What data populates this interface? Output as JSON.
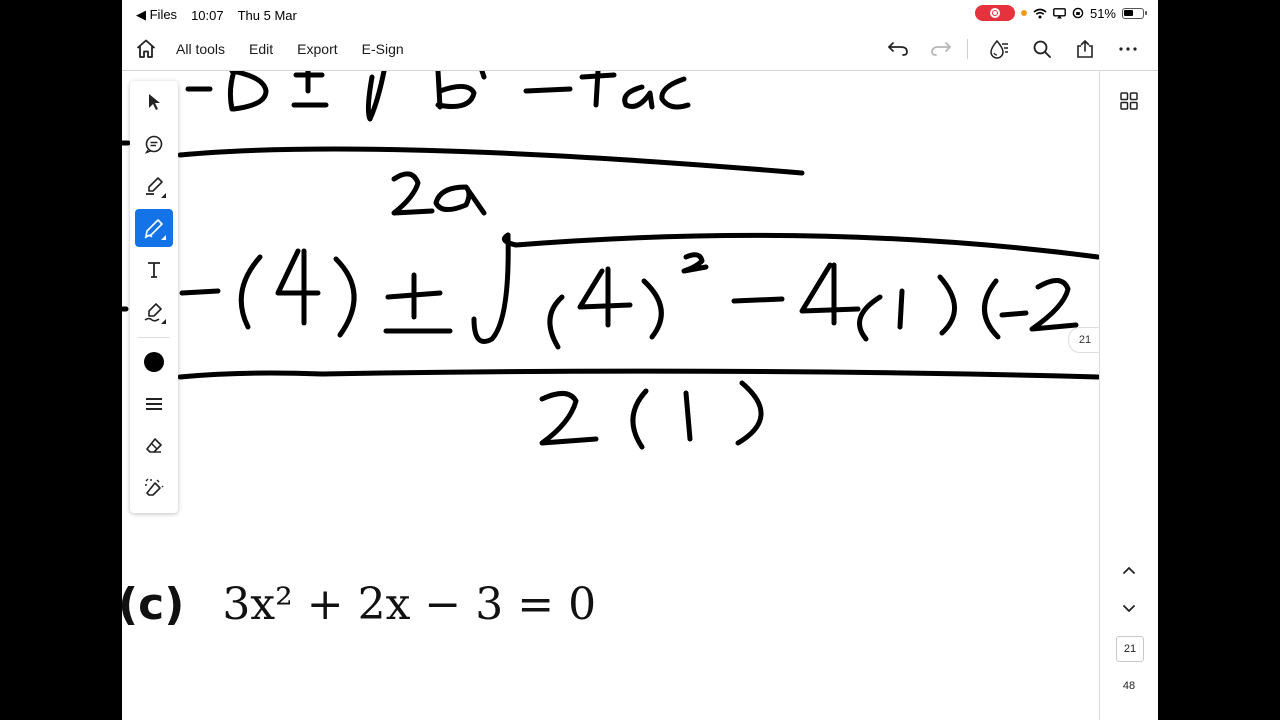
{
  "status_bar": {
    "back_app": "Files",
    "time": "10:07",
    "date": "Thu 5 Mar",
    "battery": "51%"
  },
  "toolbar": {
    "menu": [
      "All tools",
      "Edit",
      "Export",
      "E-Sign"
    ]
  },
  "canvas": {
    "page_badge": "21",
    "problem_label": "(c)",
    "problem_equation": "3x² + 2x − 3 = 0"
  },
  "right_panel": {
    "current_page": "21",
    "total_pages": "48"
  },
  "draw_tools": {
    "active": "pen-tool",
    "ink_color": "#000000",
    "accent": "#1473e6"
  }
}
